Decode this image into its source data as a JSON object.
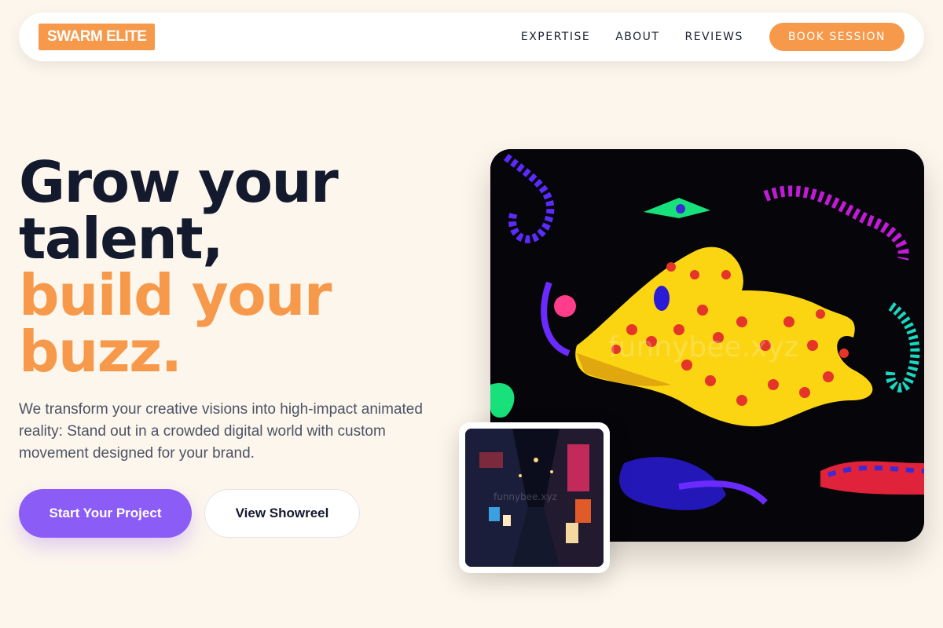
{
  "brand": {
    "logo_text": "SWARM ELITE",
    "accent": "#f7994a",
    "primary": "#8b5cf6",
    "background": "#fdf6ec"
  },
  "nav": {
    "links": [
      "EXPERTISE",
      "ABOUT",
      "REVIEWS"
    ],
    "cta": "BOOK SESSION"
  },
  "hero": {
    "headline_dark": [
      "Grow your",
      "talent,"
    ],
    "headline_accent": [
      "build your",
      "buzz."
    ],
    "description": "We transform your creative visions into high-impact animated reality: Stand out in a crowded digital world with custom movement designed for your brand.",
    "primary_button": "Start Your Project",
    "secondary_button": "View Showreel"
  },
  "images": {
    "main_watermark": "funnybee.xyz",
    "thumb_watermark": "funnybee.xyz",
    "main_icon": "neon-creature-image",
    "thumb_icon": "night-alley-image"
  }
}
